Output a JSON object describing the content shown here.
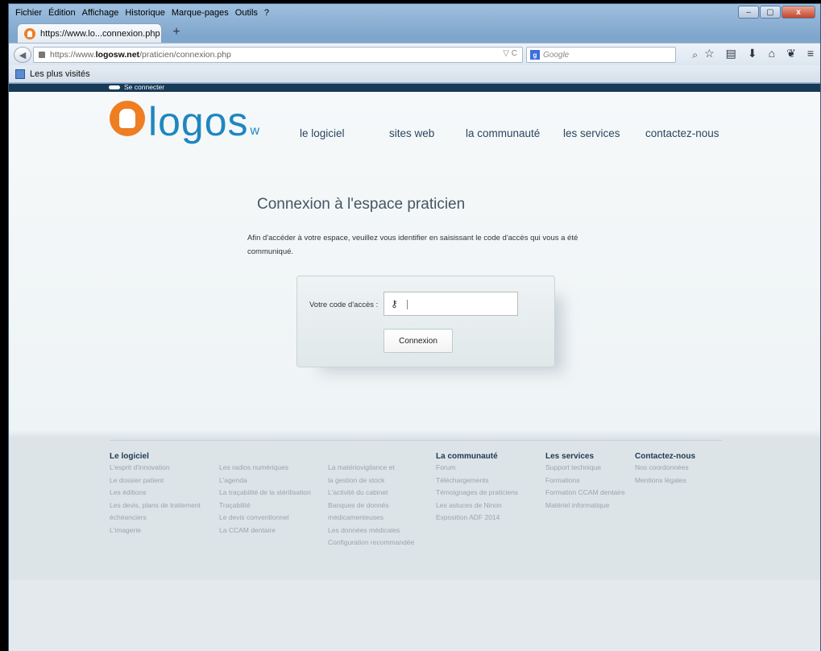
{
  "browser": {
    "menu": [
      "Fichier",
      "Édition",
      "Affichage",
      "Historique",
      "Marque-pages",
      "Outils",
      "?"
    ],
    "window_controls": [
      "–",
      "▢",
      "x"
    ],
    "tab_title": "https://www.lo...connexion.php",
    "new_tab": "+",
    "url_prefix": "https://www.",
    "url_host": "logosw.net",
    "url_path": "/praticien/connexion.php",
    "url_right": "▽ C",
    "search_placeholder": "Google",
    "bookmark": "Les plus visités"
  },
  "site": {
    "connect": "Se connecter",
    "logo_text": "logos",
    "logo_sub": "w",
    "nav": [
      "le logiciel",
      "sites web",
      "la communauté",
      "les services",
      "contactez-nous"
    ]
  },
  "login": {
    "title": "Connexion à l'espace praticien",
    "intro": "Afin d'accéder à votre espace, veuillez vous identifier en saisissant le code d'accès qui vous a été communiqué.",
    "label": "Votre code d'accès :",
    "code_value": "",
    "button": "Connexion"
  },
  "footer": {
    "cols": [
      {
        "heading": "Le logiciel",
        "items": [
          "L'esprit d'innovation",
          "Le dossier patient",
          "Les éditions",
          "Les devis, plans de traitement",
          "échéanciers",
          "L'imagerie"
        ]
      },
      {
        "heading": "",
        "items": [
          "Les radios numériques",
          "L'agenda",
          "La traçabilité de la stérilisation",
          "Traçabilité",
          "Le devis conventionnel",
          "La CCAM dentaire"
        ]
      },
      {
        "heading": "",
        "items": [
          "La matériovigilance et",
          "la gestion de stock",
          "L'activité du cabinet",
          "Banques de donnés",
          "médicamenteuses",
          "Les données médicales",
          "Configuration recommandée"
        ]
      },
      {
        "heading": "La communauté",
        "items": [
          "Forum",
          "Téléchargements",
          "Témoignages de praticiens",
          "Les astuces de Ninon",
          "Exposition ADF 2014"
        ]
      },
      {
        "heading": "Les services",
        "items": [
          "Support technique",
          "Formations",
          "Formation CCAM dentaire",
          "Matériel informatique"
        ]
      },
      {
        "heading": "Contactez-nous",
        "items": [
          "Nos coordonnées",
          "Mentions légales"
        ]
      }
    ]
  }
}
